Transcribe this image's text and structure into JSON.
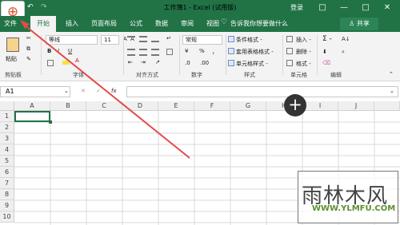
{
  "window": {
    "title": "工作簿1 - Excel (试用版)",
    "sign_in": "登录"
  },
  "ribbon": {
    "tabs": [
      "文件",
      "开始",
      "插入",
      "页面布局",
      "公式",
      "数据",
      "审阅",
      "视图"
    ],
    "tell_me": "告诉我你想要做什么",
    "share": "共享",
    "clipboard": {
      "paste": "粘贴",
      "group": "剪贴板"
    },
    "font": {
      "name": "等线",
      "size": "11",
      "bold": "B",
      "italic": "I",
      "underline": "U",
      "font_color": "A",
      "group": "字体"
    },
    "alignment": {
      "group": "对齐方式"
    },
    "number": {
      "format": "常规",
      "percent": "%",
      "comma": "，",
      "group": "数字"
    },
    "styles": {
      "conditional": "条件格式 -",
      "table": "套用表格格式 -",
      "cell": "单元格样式 -",
      "group": "样式"
    },
    "cells": {
      "insert": "插入 -",
      "delete": "删除 -",
      "format": "格式 -",
      "group": "单元格"
    },
    "editing": {
      "sum": "Σ -",
      "group": "编辑"
    }
  },
  "formula_bar": {
    "name_box": "A1",
    "function_label": "fx",
    "value": ""
  },
  "sheet": {
    "columns": [
      "A",
      "B",
      "C",
      "D",
      "E",
      "F",
      "G",
      "H",
      "I",
      "J"
    ],
    "rows": [
      "1",
      "2",
      "3",
      "4",
      "5",
      "6",
      "7",
      "8",
      "9",
      "10"
    ],
    "active_cell": "A1"
  },
  "watermark": {
    "main": "雨林木风",
    "url": "WWW.YLMFU.COM"
  }
}
